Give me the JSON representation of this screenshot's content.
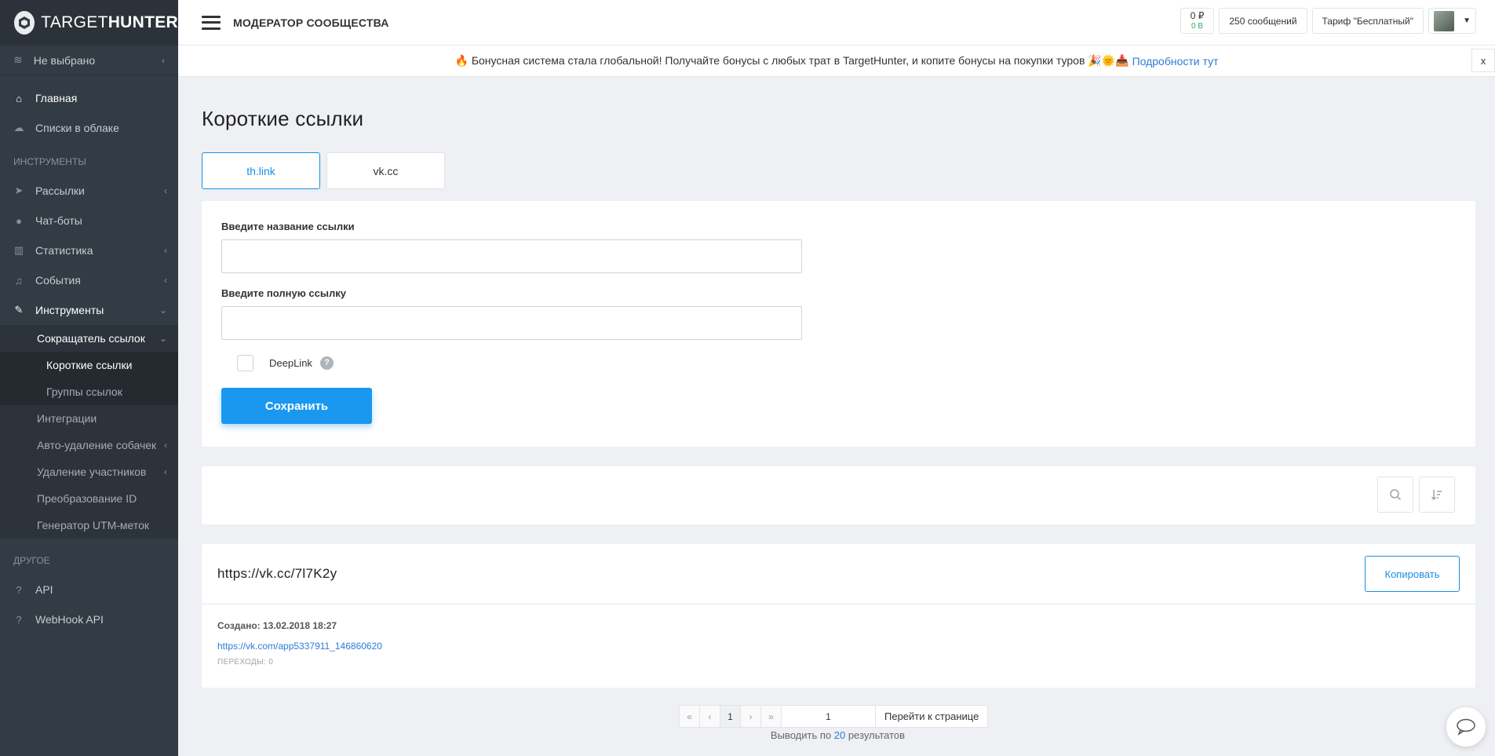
{
  "brand": {
    "name_light": "TARGET",
    "name_bold": "HUNTER"
  },
  "sidebar": {
    "project_select": "Не выбрано",
    "main_items": [
      {
        "label": "Главная",
        "icon": "home-icon"
      },
      {
        "label": "Списки в облаке",
        "icon": "cloud-icon"
      }
    ],
    "section_tools": "ИНСТРУМЕНТЫ",
    "tool_items": [
      {
        "label": "Рассылки",
        "icon": "send-icon"
      },
      {
        "label": "Чат-боты",
        "icon": "bot-icon"
      },
      {
        "label": "Статистика",
        "icon": "stats-icon"
      },
      {
        "label": "События",
        "icon": "bell-icon"
      },
      {
        "label": "Инструменты",
        "icon": "wrench-icon"
      }
    ],
    "tools_sub": {
      "shortener": "Сокращатель ссылок",
      "shortener_children": [
        "Короткие ссылки",
        "Группы ссылок"
      ],
      "items": [
        "Интеграции",
        "Авто-удаление собачек",
        "Удаление участников",
        "Преобразование ID",
        "Генератор UTM-меток"
      ]
    },
    "section_other": "ДРУГОЕ",
    "other_items": [
      {
        "label": "API",
        "icon": "help-icon"
      },
      {
        "label": "WebHook API",
        "icon": "help-icon"
      }
    ]
  },
  "topbar": {
    "title": "МОДЕРАТОР СООБЩЕСТВА",
    "balance_rub": "0 ₽",
    "balance_b": "0 B",
    "messages": "250 сообщений",
    "tariff": "Тариф \"Бесплатный\""
  },
  "banner": {
    "text": "🔥 Бонусная система стала глобальной! Получайте бонусы с любых трат в TargetHunter, и копите бонусы на покупки туров 🎉🌞📥",
    "link": "Подробности тут",
    "close": "x"
  },
  "page": {
    "title": "Короткие ссылки",
    "tabs": [
      "th.link",
      "vk.cc"
    ]
  },
  "form": {
    "name_label": "Введите название ссылки",
    "url_label": "Введите полную ссылку",
    "deeplink_label": "DeepLink",
    "help": "?",
    "save": "Сохранить"
  },
  "link": {
    "short_url": "https://vk.cc/7l7K2y",
    "copy": "Копировать",
    "created": "Создано: 13.02.2018 18:27",
    "full_url": "https://vk.com/app5337911_146860620",
    "clicks": "ПЕРЕХОДЫ: 0"
  },
  "pagination": {
    "first": "«",
    "prev": "‹",
    "current": "1",
    "next": "›",
    "last": "»",
    "input_value": "1",
    "go": "Перейти к странице",
    "per_page_prefix": "Выводить по",
    "per_page": "20",
    "per_page_suffix": "результатов"
  }
}
